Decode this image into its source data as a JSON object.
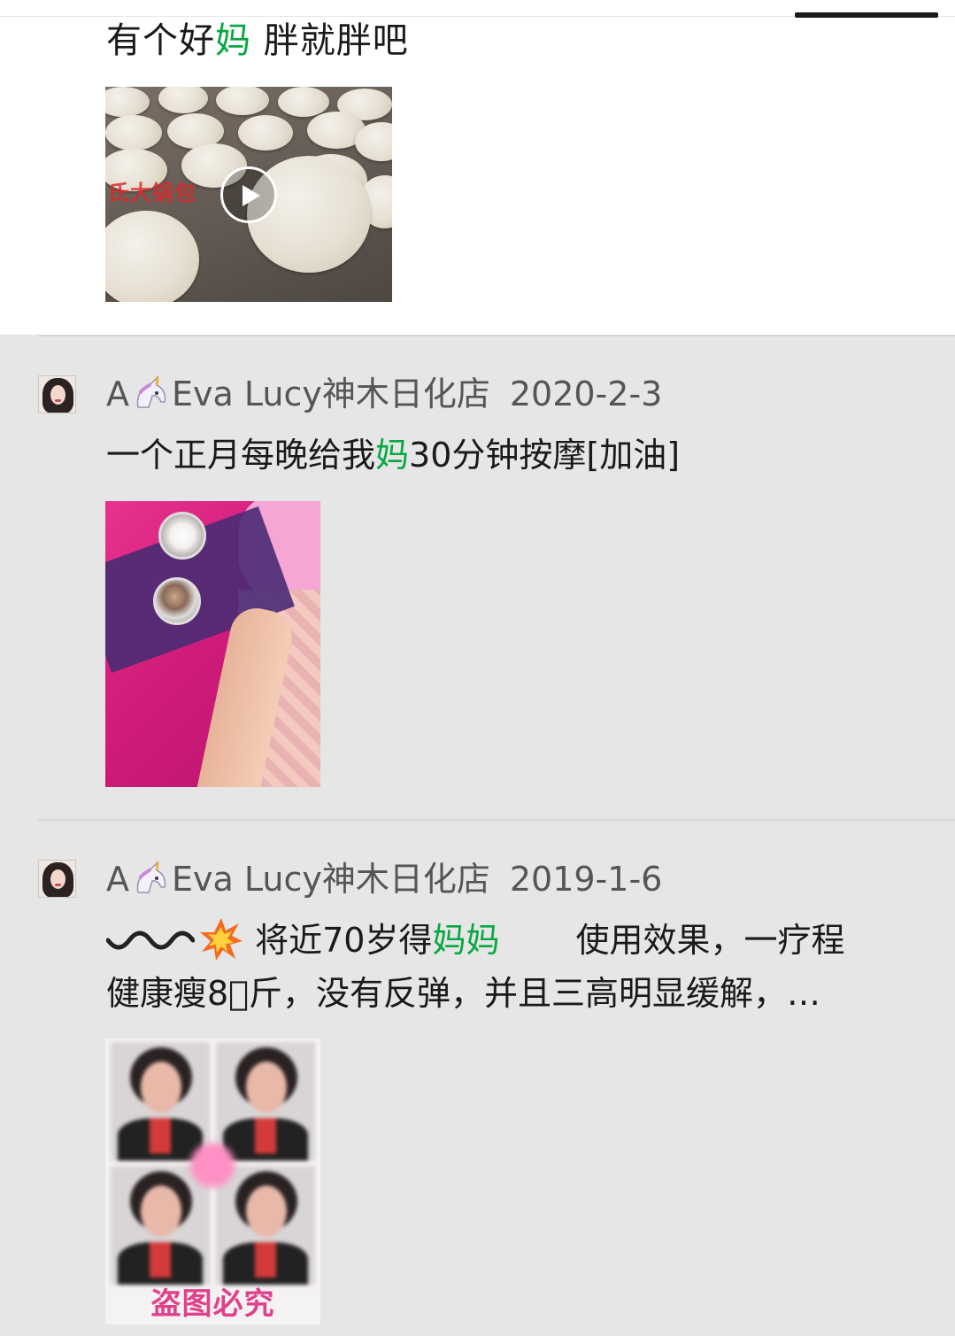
{
  "post1": {
    "text_before": "有个好",
    "text_highlight": "妈",
    "text_after": " 胖就胖吧",
    "video_label": "氏大锅包"
  },
  "post2": {
    "author_prefix": "A",
    "author_icon": "unicorn-emoji",
    "author_name": "Eva Lucy神木日化店",
    "date": "2020-2-3",
    "text_before": "一个正月每晚给我",
    "text_highlight": "妈",
    "text_after": "30分钟按摩[加油]"
  },
  "post3": {
    "author_prefix": "A",
    "author_icon": "unicorn-emoji",
    "author_name": "Eva Lucy神木日化店",
    "date": "2019-1-6",
    "line1_icons": [
      "wave-emoji",
      "collision-emoji"
    ],
    "line1_before": " 将近70岁得",
    "line1_highlight": "妈妈",
    "line1_after": "使用效果，一疗程",
    "line2": "健康瘦8\u0000斤，没有反弹，并且三高明显缓解，…",
    "image_stamp": "盗图必究"
  },
  "colors": {
    "highlight": "#07a742",
    "feed_background": "#e6e6e6",
    "post_background": "#ffffff"
  }
}
